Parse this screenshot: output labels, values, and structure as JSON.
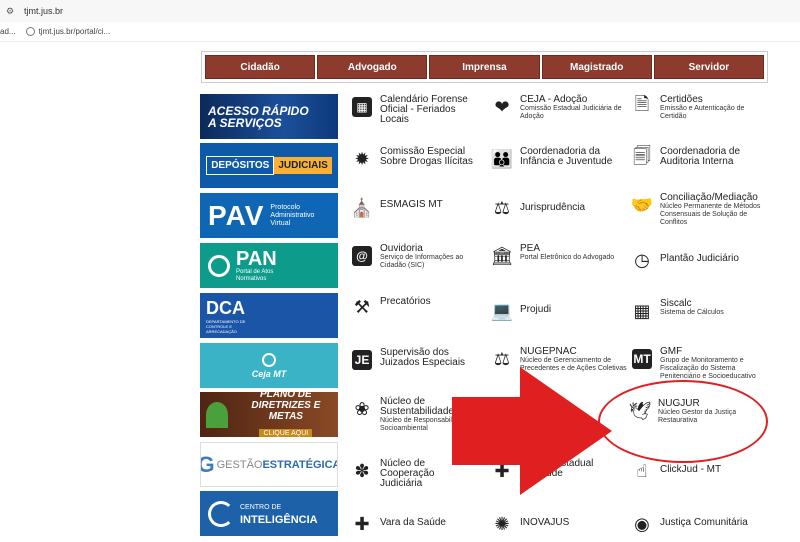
{
  "browser": {
    "address": "tjmt.jus.br",
    "bookmark_left": "ad...",
    "bookmark": "tjmt.jus.br/portal/ci..."
  },
  "nav": [
    "Cidadão",
    "Advogado",
    "Imprensa",
    "Magistrado",
    "Servidor"
  ],
  "banners": {
    "acesso": "ACESSO RÁPIDO A SERVIÇOS",
    "depositos_a": "DEPÓSITOS",
    "depositos_b": "JUDICIAIS",
    "pav_big": "PAV",
    "pav_sm": "Protocolo Administrativo Virtual",
    "pan_big": "PAN",
    "pan_sm": "Portal de Atos Normativos",
    "dca_big": "DCA",
    "dca_dept": "DEPARTAMENTO DE CONTROLE E ARRECADAÇÃO",
    "ceja": "Ceja MT",
    "plano_a": "PLANO DE",
    "plano_b": "DIRETRIZES E METAS",
    "plano_cta": "CLIQUE AQUI",
    "gestao_a": "GESTÃO",
    "gestao_b": "ESTRATÉGICA",
    "centro_a": "CENTRO DE",
    "centro_b": "INTELIGÊNCIA"
  },
  "links": {
    "calendario": {
      "label": "Calendário Forense Oficial - Feriados Locais"
    },
    "ceja_adocao": {
      "label": "CEJA - Adoção",
      "sub": "Comissão Estadual Judiciária de Adoção"
    },
    "certidoes": {
      "label": "Certidões",
      "sub": "Emissão e Autenticação de Certidão"
    },
    "comissao_drogas": {
      "label": "Comissão Especial Sobre Drogas Ilícitas"
    },
    "coord_infancia": {
      "label": "Coordenadoria da Infância e Juventude"
    },
    "coord_auditoria": {
      "label": "Coordenadoria de Auditoria Interna"
    },
    "esmagis": {
      "label": "ESMAGIS MT"
    },
    "jurisprudencia": {
      "label": "Jurisprudência"
    },
    "conciliacao": {
      "label": "Conciliação/Mediação",
      "sub": "Núcleo Permanente de Métodos Consensuais de Solução de Conflitos"
    },
    "ouvidoria": {
      "label": "Ouvidoria",
      "sub": "Serviço de Informações ao Cidadão (SIC)"
    },
    "pea": {
      "label": "PEA",
      "sub": "Portal Eletrônico do Advogado"
    },
    "plantao": {
      "label": "Plantão Judiciário"
    },
    "precatorios": {
      "label": "Precatórios"
    },
    "projudi": {
      "label": "Projudi"
    },
    "siscalc": {
      "label": "Siscalc",
      "sub": "Sistema de Cálculos"
    },
    "supervisao": {
      "label": "Supervisão dos Juizados Especiais"
    },
    "nugepnac": {
      "label": "NUGEPNAC",
      "sub": "Núcleo de Gerenciamento de Precedentes e de Ações Coletivas"
    },
    "gmf": {
      "label": "GMF",
      "sub": "Grupo de Monitoramento e Fiscalização do Sistema Penitenciário e Socioeducativo"
    },
    "sustentabilidade": {
      "label": "Núcleo de Sustentabilidade",
      "sub": "Núcleo de Responsabilidade Socioambiental"
    },
    "nugjur": {
      "label": "NUGJUR",
      "sub": "Núcleo Gestor da Justiça Restaurativa"
    },
    "cooperacao": {
      "label": "Núcleo de Cooperação Judiciária"
    },
    "comite_saude": {
      "label": "Comitê Estadual de Saúde"
    },
    "clickjud": {
      "label": "ClickJud - MT"
    },
    "vara_saude": {
      "label": "Vara da Saúde"
    },
    "inovajus": {
      "label": "INOVAJUS"
    },
    "justica_comunitaria": {
      "label": "Justiça Comunitária"
    }
  },
  "colors": {
    "nav_bg": "#8c3b2e",
    "arrow": "#e02020"
  }
}
